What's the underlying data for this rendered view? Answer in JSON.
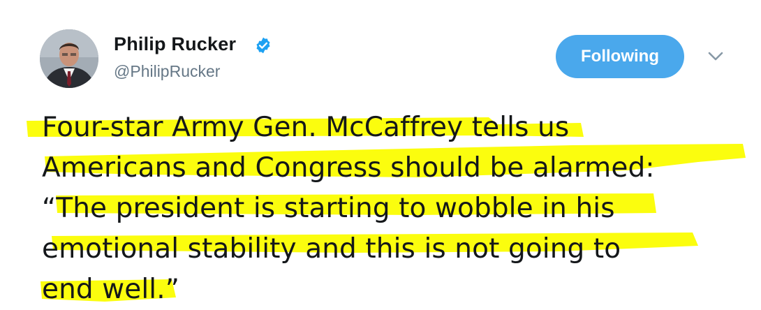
{
  "author": {
    "name": "Philip Rucker",
    "handle": "@PhilipRucker",
    "verified": true
  },
  "actions": {
    "follow_label": "Following",
    "menu_icon": "chevron-down-icon"
  },
  "tweet": {
    "text": "Four-star Army Gen. McCaffrey tells us\nAmericans and Congress should be alarmed:\n“The president is starting to wobble in his\nemotional stability and this is not going to\nend well.”"
  },
  "colors": {
    "follow_button": "#4aa8ec",
    "verified_badge": "#1da1f2",
    "highlight": "#fbfd0e",
    "handle": "#657786"
  }
}
